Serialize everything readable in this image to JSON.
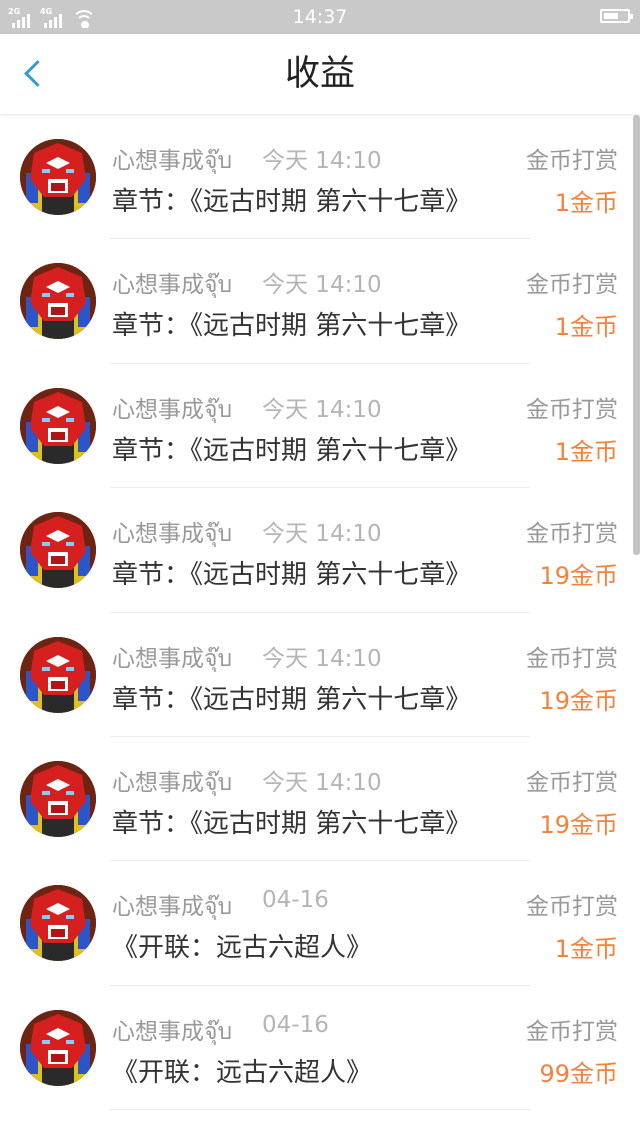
{
  "status_bar": {
    "time": "14:37",
    "network_1": "2G",
    "network_2": "4G",
    "battery_level": 0.65,
    "signal_icon": "signal-icon",
    "wifi_icon": "wifi-icon",
    "battery_icon": "battery-icon"
  },
  "header": {
    "title": "收益",
    "back_icon": "chevron-left-icon"
  },
  "colors": {
    "accent": "#2e9bdb",
    "amount": "#f5823b",
    "secondary_text": "#999999",
    "primary_text": "#333333",
    "status_bar": "#c9c9c9"
  },
  "records": [
    {
      "user": "心想事成จุ๊บ",
      "time": "今天 14:10",
      "type": "金币打赏",
      "content": "章节：《远古时期 第六十七章》",
      "amount": "1金币"
    },
    {
      "user": "心想事成จุ๊บ",
      "time": "今天 14:10",
      "type": "金币打赏",
      "content": "章节：《远古时期 第六十七章》",
      "amount": "1金币"
    },
    {
      "user": "心想事成จุ๊บ",
      "time": "今天 14:10",
      "type": "金币打赏",
      "content": "章节：《远古时期 第六十七章》",
      "amount": "1金币"
    },
    {
      "user": "心想事成จุ๊บ",
      "time": "今天 14:10",
      "type": "金币打赏",
      "content": "章节：《远古时期 第六十七章》",
      "amount": "19金币"
    },
    {
      "user": "心想事成จุ๊บ",
      "time": "今天 14:10",
      "type": "金币打赏",
      "content": "章节：《远古时期 第六十七章》",
      "amount": "19金币"
    },
    {
      "user": "心想事成จุ๊บ",
      "time": "今天 14:10",
      "type": "金币打赏",
      "content": "章节：《远古时期 第六十七章》",
      "amount": "19金币"
    },
    {
      "user": "心想事成จุ๊บ",
      "time": "04-16",
      "type": "金币打赏",
      "content": "《开联：远古六超人》",
      "amount": "1金币"
    },
    {
      "user": "心想事成จุ๊บ",
      "time": "04-16",
      "type": "金币打赏",
      "content": "《开联：远古六超人》",
      "amount": "99金币"
    }
  ]
}
